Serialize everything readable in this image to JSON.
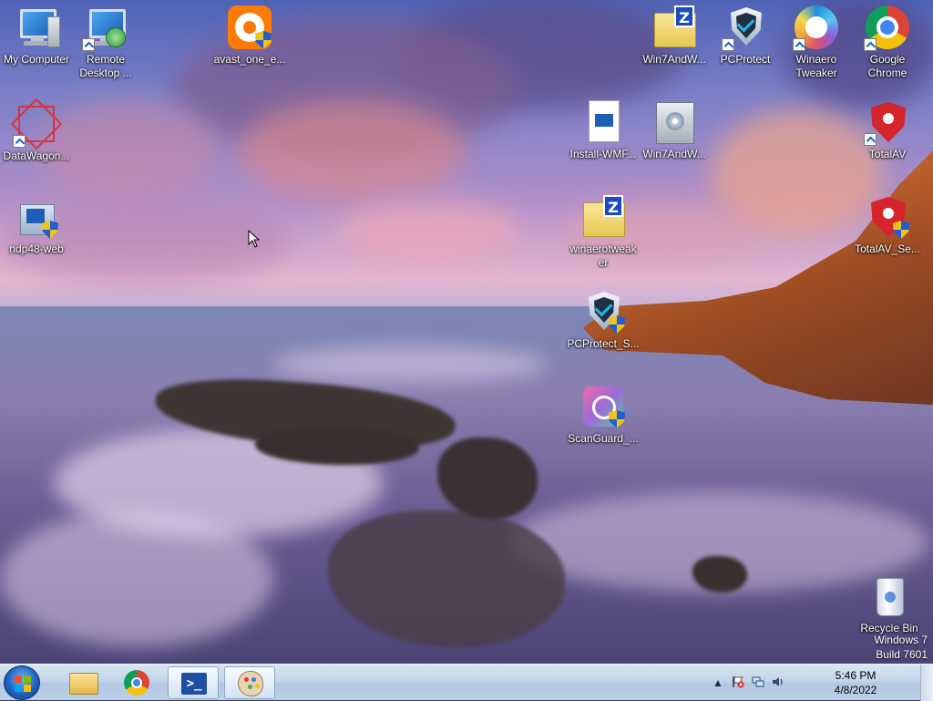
{
  "desktop": {
    "icons": [
      {
        "label": "My Computer"
      },
      {
        "label": "Remote Desktop ..."
      },
      {
        "label": "avast_one_e..."
      },
      {
        "label": "DataWagon..."
      },
      {
        "label": "ndp48-web"
      },
      {
        "label": "Win7AndW..."
      },
      {
        "label": "PCProtect"
      },
      {
        "label": "Winaero Tweaker"
      },
      {
        "label": "Google Chrome"
      },
      {
        "label": "Install-WMF..."
      },
      {
        "label": "Win7AndW..."
      },
      {
        "label": "TotalAV"
      },
      {
        "label": "winaerotweaker"
      },
      {
        "label": "TotalAV_Se..."
      },
      {
        "label": "PCProtect_S..."
      },
      {
        "label": "ScanGuard_..."
      },
      {
        "label": "Recycle Bin"
      }
    ]
  },
  "watermark": {
    "line1": "Windows 7",
    "line2": "Build 7601"
  },
  "taskbar": {
    "pinned": [
      {
        "name": "Windows Explorer"
      },
      {
        "name": "Google Chrome"
      },
      {
        "name": "Windows PowerShell",
        "glyph": ">_"
      },
      {
        "name": "Paint"
      }
    ],
    "tray": {
      "show_hidden_glyph": "▲",
      "time": "5:46 PM",
      "date": "4/8/2022"
    }
  },
  "colors": {
    "taskbar": "#c3d6ea",
    "accent": "#1f63c2"
  }
}
